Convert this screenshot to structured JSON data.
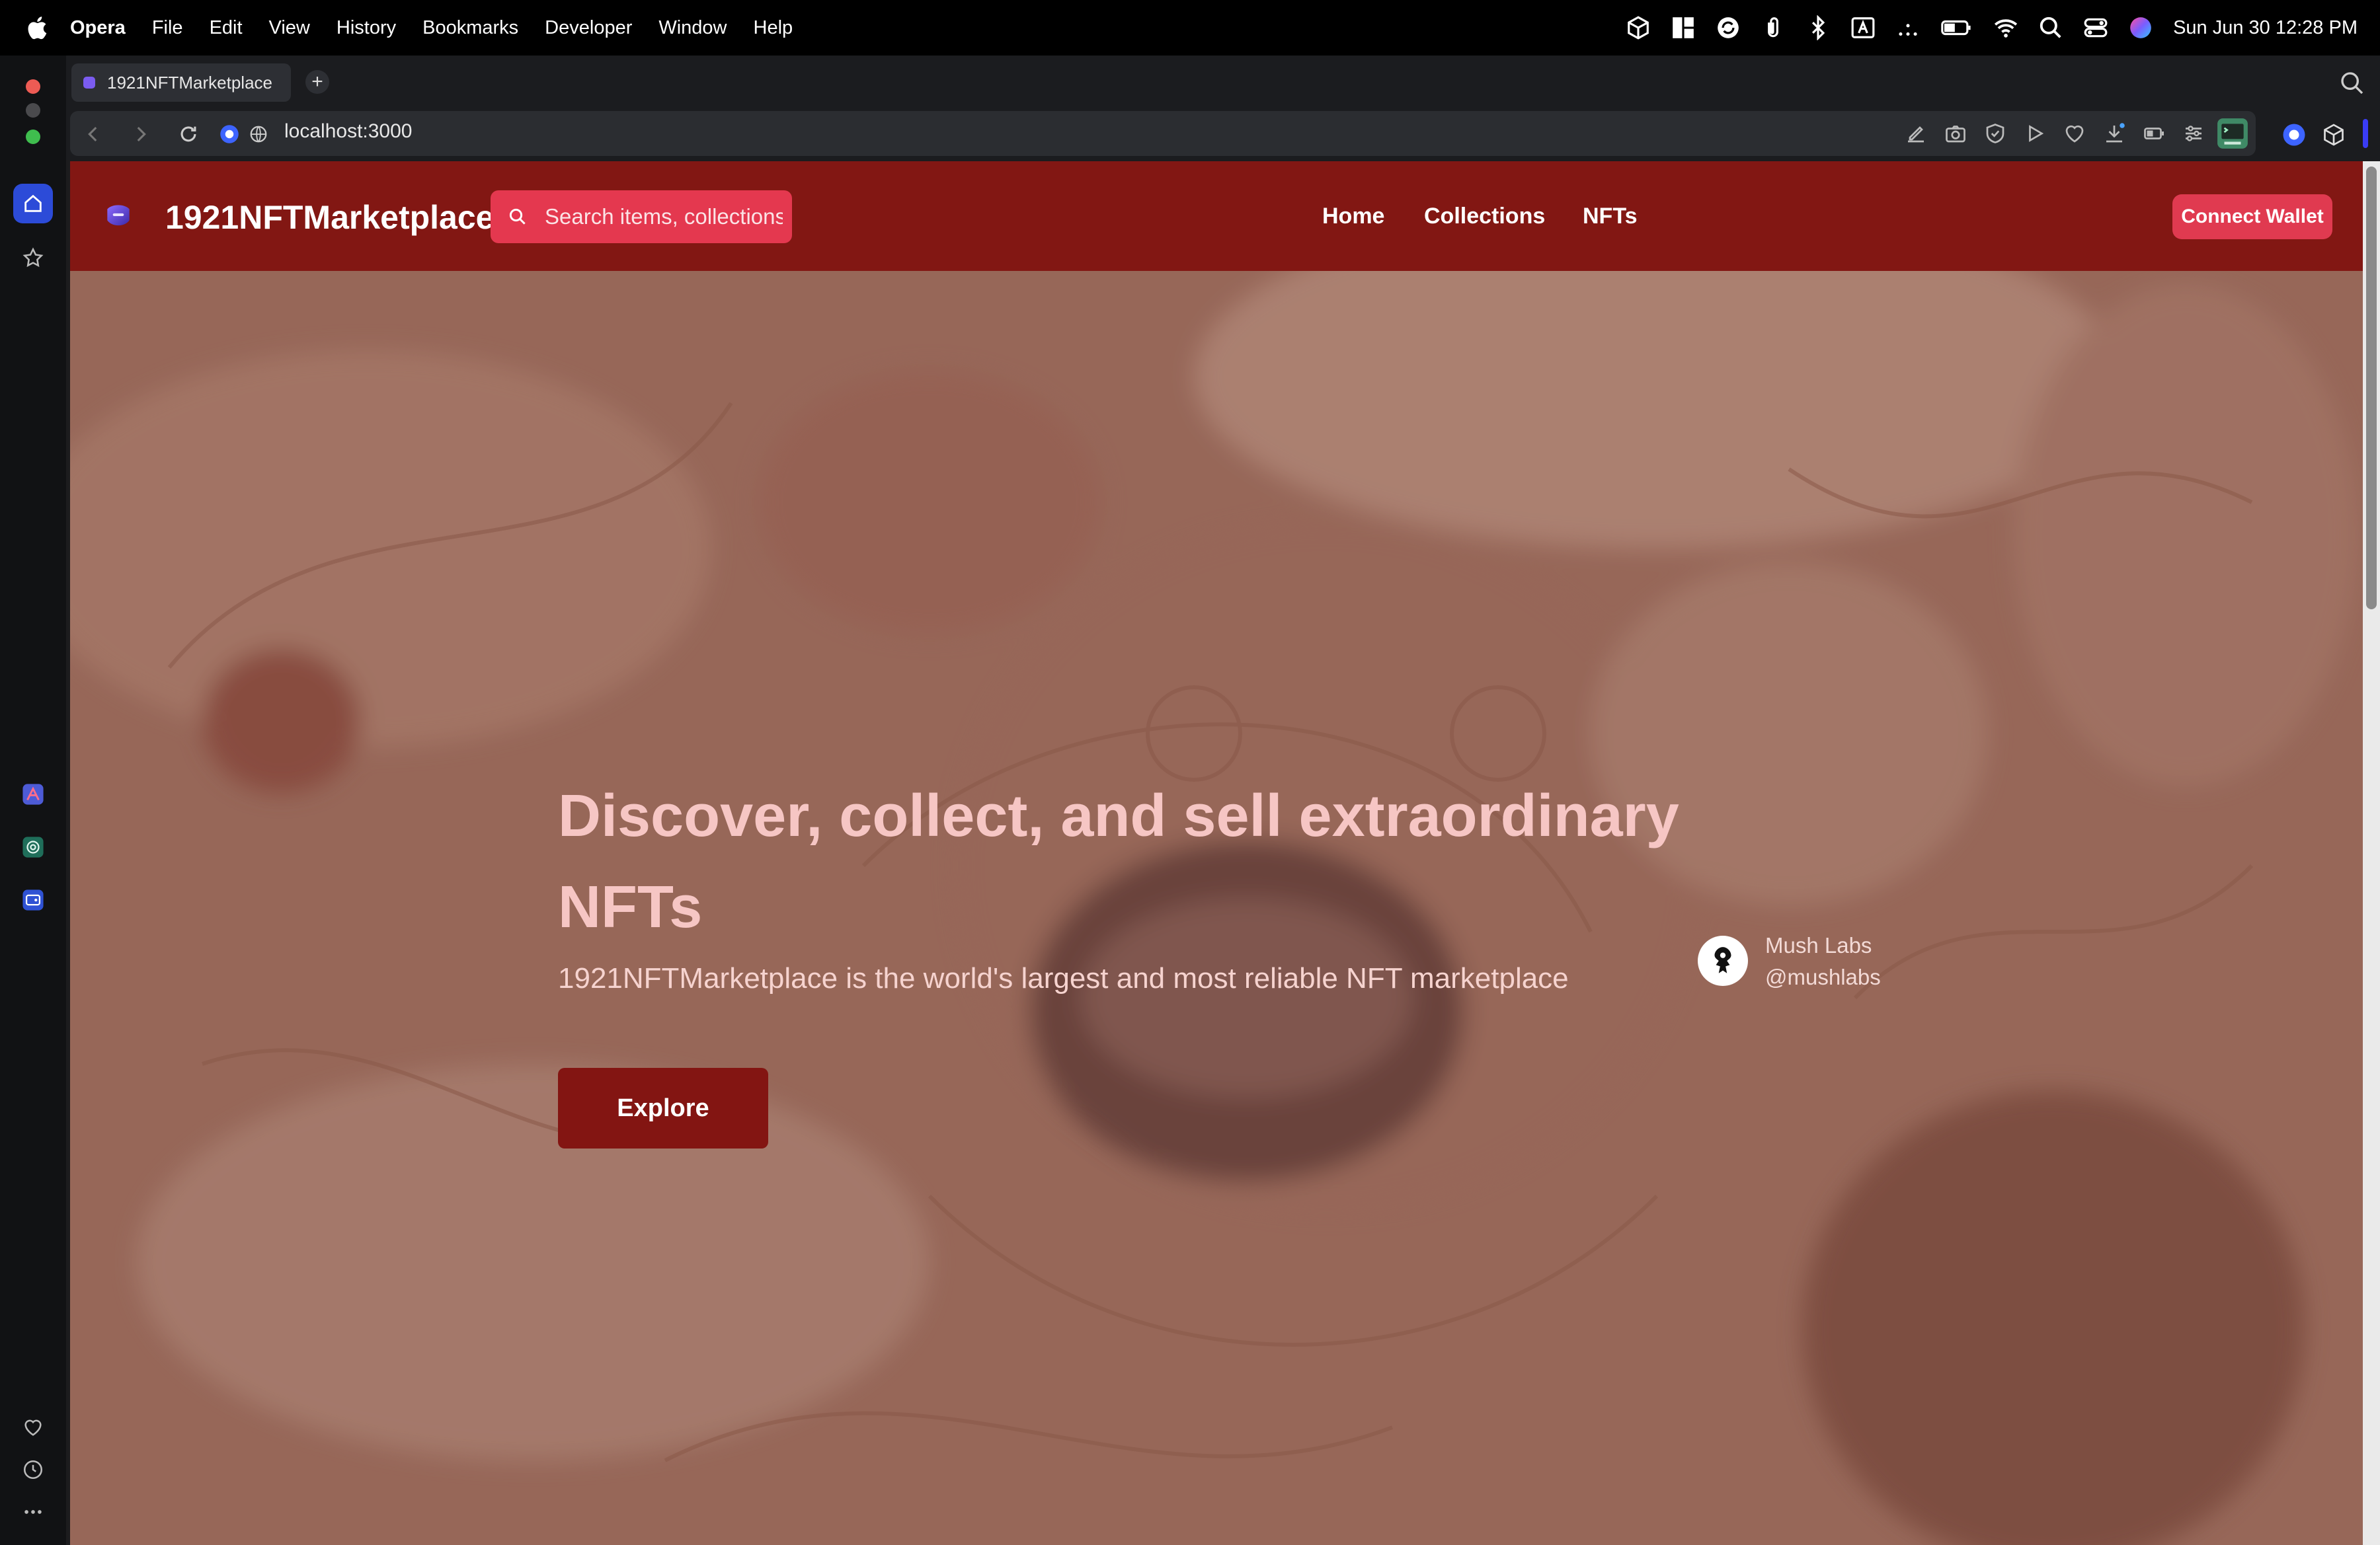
{
  "menubar": {
    "app_name": "Opera",
    "items": [
      "File",
      "Edit",
      "View",
      "History",
      "Bookmarks",
      "Developer",
      "Window",
      "Help"
    ],
    "clock": "Sun Jun 30  12:28 PM",
    "status_icons": [
      "box-icon",
      "grid-icon",
      "sync-icon",
      "paperclip-icon",
      "bluetooth-icon",
      "keyboard-a-icon",
      "dots-icon",
      "battery-icon",
      "wifi-icon",
      "spotlight-search-icon",
      "control-center-icon",
      "siri-icon"
    ]
  },
  "browser": {
    "tab_title": "1921NFTMarketplace",
    "new_tab_label": "+",
    "url": "localhost:3000",
    "sidebar_icons": [
      "home-icon",
      "star-icon",
      "aria-app-icon",
      "chatgpt-app-icon",
      "wallet-app-icon",
      "heart-icon",
      "history-icon",
      "more-icon"
    ]
  },
  "site": {
    "brand": "1921NFTMarketplace",
    "search_placeholder": "Search items, collections",
    "nav": {
      "home": "Home",
      "collections": "Collections",
      "nfts": "NFTs"
    },
    "connect_wallet": "Connect Wallet",
    "colors": {
      "navbar": "#821713",
      "search_bg": "#e4384f",
      "button_accent": "#e03a50",
      "explore_bg": "#831512"
    }
  },
  "hero": {
    "title": "Discover, collect, and sell extraordinary NFTs",
    "subtitle": "1921NFTMarketplace is the world's largest and most reliable NFT marketplace",
    "cta": "Explore",
    "creator": {
      "name": "Mush Labs",
      "handle": "@mushlabs"
    }
  }
}
